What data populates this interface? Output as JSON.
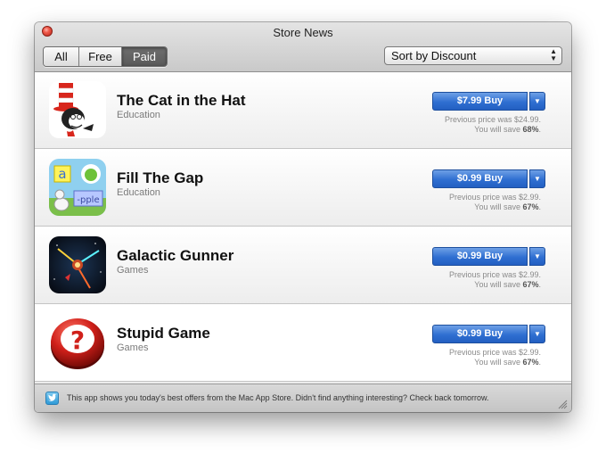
{
  "window": {
    "title": "Store News"
  },
  "filters": {
    "items": [
      "All",
      "Free",
      "Paid"
    ],
    "active": "Paid"
  },
  "sort": {
    "label": "Sort by Discount"
  },
  "apps": [
    {
      "name": "The Cat in the Hat",
      "category": "Education",
      "buy_label": "$7.99 Buy",
      "previous": "Previous price was $24.99.",
      "save_prefix": "You will save ",
      "save_pct": "68%",
      "icon": "cat-in-the-hat-icon"
    },
    {
      "name": "Fill The Gap",
      "category": "Education",
      "buy_label": "$0.99 Buy",
      "previous": "Previous price was $2.99.",
      "save_prefix": "You will save ",
      "save_pct": "67%",
      "icon": "fill-the-gap-icon"
    },
    {
      "name": "Galactic Gunner",
      "category": "Games",
      "buy_label": "$0.99 Buy",
      "previous": "Previous price was $2.99.",
      "save_prefix": "You will save ",
      "save_pct": "67%",
      "icon": "galactic-gunner-icon"
    },
    {
      "name": "Stupid Game",
      "category": "Games",
      "buy_label": "$0.99 Buy",
      "previous": "Previous price was $2.99.",
      "save_prefix": "You will save ",
      "save_pct": "67%",
      "icon": "stupid-game-icon"
    }
  ],
  "status": {
    "text": "This app shows you today's best offers from the Mac App Store. Didn't find anything interesting? Check back tomorrow."
  },
  "colors": {
    "buy_button": "#2f6fd1",
    "close_button": "#ef5a4a"
  }
}
